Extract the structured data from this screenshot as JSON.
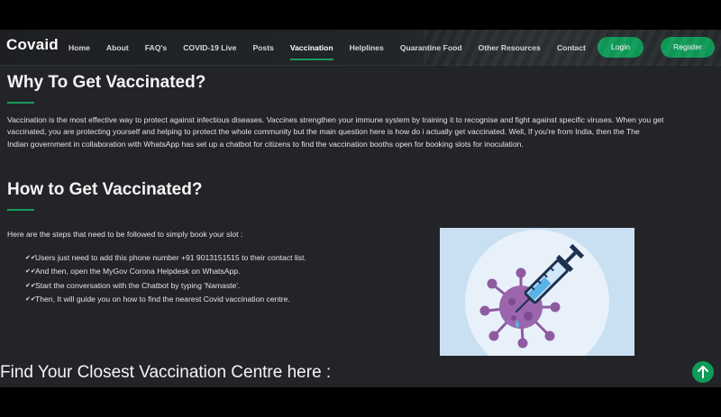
{
  "navbar": {
    "brand": "Covaid",
    "links": [
      {
        "label": "Home"
      },
      {
        "label": "About"
      },
      {
        "label": "FAQ's"
      },
      {
        "label": "COVID-19 Live"
      },
      {
        "label": "Posts"
      },
      {
        "label": "Vaccination",
        "active": true
      },
      {
        "label": "Helplines"
      },
      {
        "label": "Quarantine Food"
      },
      {
        "label": "Other Resources"
      },
      {
        "label": "Contact"
      }
    ],
    "login_label": "Login",
    "register_label": "Register"
  },
  "why": {
    "title": "Why To Get Vaccinated?",
    "paragraph_lines": [
      "Vaccination is the most effective way to protect against infectious diseases. Vaccines strengthen your immune system by training it to recognise and fight against specific viruses. When you get",
      "vaccinated, you are protecting yourself and helping to protect the whole community but the main question here is how do i actually get vaccinated. Well, If you're from India, then the The",
      "Indian government in collaboration with WhatsApp has set up a chatbot for citizens to find the vaccination booths open for booking slots for inoculation."
    ]
  },
  "how": {
    "title": "How to Get Vaccinated?",
    "intro": "Here are the steps that need to be followed to simply book your slot :",
    "steps": [
      "Users just need to add this phone number +91 9013151515 to their contact list.",
      "And then, open the MyGov Corona Helpdesk on WhatsApp.",
      "Start the conversation with the Chatbot by typing 'Namaste'.",
      "Then, It will guide you on how to find the nearest Covid vaccination centre."
    ]
  },
  "find": {
    "title": "Find Your Closest Vaccination Centre here :"
  },
  "icons": {
    "step_marker": "check-double-icon",
    "back_to_top": "arrow-up-icon",
    "illustration": "virus-syringe-illustration"
  },
  "colors": {
    "accent": "#0f9b58",
    "background": "#222428",
    "illustration_bg": "#c9dff2"
  }
}
